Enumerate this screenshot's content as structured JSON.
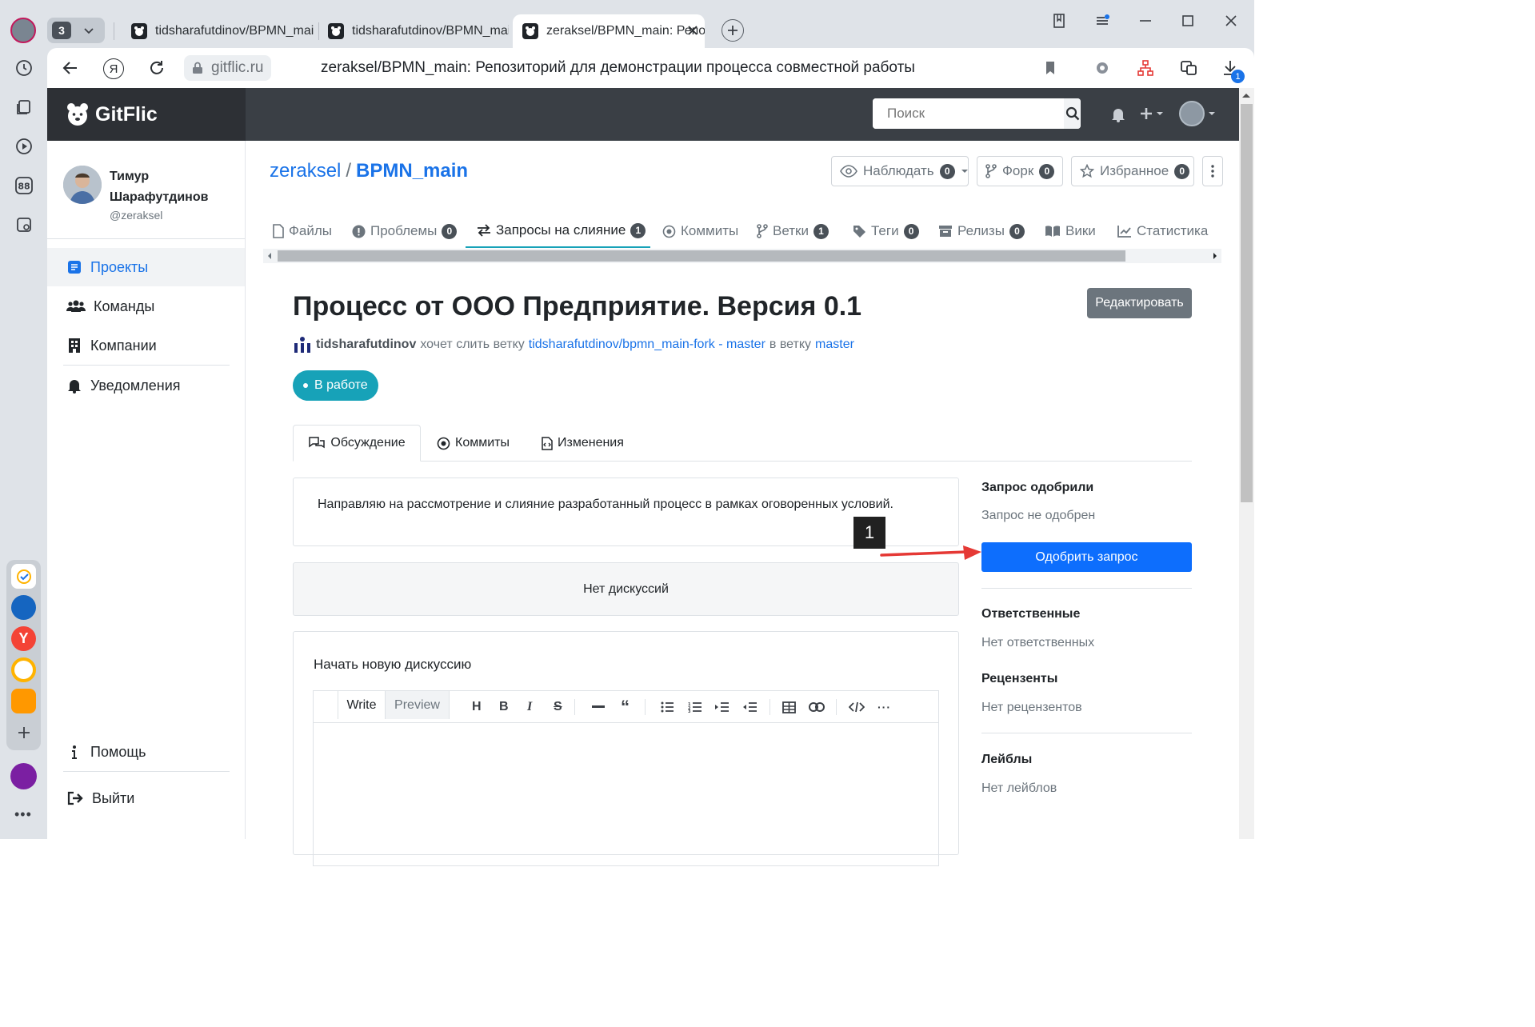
{
  "browser": {
    "tab_count": "3",
    "tabs": [
      {
        "title": "tidsharafutdinov/BPMN_main"
      },
      {
        "title": "tidsharafutdinov/BPMN_main"
      },
      {
        "title": "zeraksel/BPMN_main: Репозиторий"
      }
    ],
    "address": {
      "host": "gitflic.ru",
      "page_title": "zeraksel/BPMN_main: Репозиторий для демонстрации процесса совместной работы"
    },
    "downloads_badge": "1",
    "apps": [
      "Y"
    ]
  },
  "header": {
    "logo_text": "GitFlic",
    "search_placeholder": "Поиск"
  },
  "sidebar": {
    "user_name_line1": "Тимур",
    "user_name_line2": "Шарафутдинов",
    "user_handle": "@zeraksel",
    "items": [
      {
        "label": "Проекты"
      },
      {
        "label": "Команды"
      },
      {
        "label": "Компании"
      },
      {
        "label": "Уведомления"
      }
    ],
    "help_label": "Помощь",
    "logout_label": "Выйти"
  },
  "repo": {
    "owner": "zeraksel",
    "separator": "/",
    "name": "BPMN_main",
    "watch": {
      "label": "Наблюдать",
      "count": "0"
    },
    "fork": {
      "label": "Форк",
      "count": "0"
    },
    "star": {
      "label": "Избранное",
      "count": "0"
    }
  },
  "nav_tabs": [
    {
      "label": "Файлы",
      "count": ""
    },
    {
      "label": "Проблемы",
      "count": "0"
    },
    {
      "label": "Запросы на слияние",
      "count": "1"
    },
    {
      "label": "Коммиты",
      "count": ""
    },
    {
      "label": "Ветки",
      "count": "1"
    },
    {
      "label": "Теги",
      "count": "0"
    },
    {
      "label": "Релизы",
      "count": "0"
    },
    {
      "label": "Вики",
      "count": ""
    },
    {
      "label": "Статистика",
      "count": ""
    }
  ],
  "mr": {
    "title": "Процесс от ООО Предприятие. Версия 0.1",
    "edit_label": "Редактировать",
    "author": "tidsharafutdinov",
    "text_wants": "хочет слить ветку",
    "source_branch": "tidsharafutdinov/bpmn_main-fork - master",
    "text_into": "в ветку",
    "target_branch": "master",
    "status": "В работе",
    "subtabs": [
      {
        "label": "Обсуждение"
      },
      {
        "label": "Коммиты"
      },
      {
        "label": "Изменения"
      }
    ],
    "description": "Направляю на рассмотрение и слияние разработанный процесс в рамках оговоренных условий.",
    "no_discussions": "Нет дискуссий",
    "new_discussion_title": "Начать новую дискуссию",
    "editor": {
      "write_label": "Write",
      "preview_label": "Preview"
    }
  },
  "right_panel": {
    "approved_title": "Запрос одобрили",
    "approved_text": "Запрос не одобрен",
    "approve_button": "Одобрить запрос",
    "assignees_title": "Ответственные",
    "assignees_text": "Нет ответственных",
    "reviewers_title": "Рецензенты",
    "reviewers_text": "Нет рецензентов",
    "labels_title": "Лейблы",
    "labels_text": "Нет лейблов"
  },
  "annotation": {
    "marker": "1"
  },
  "colors": {
    "primary": "#0d6efd",
    "status": "#17a2b8",
    "header": "#3a3f45",
    "link": "#1a73e8",
    "annotation_arrow": "#e53935"
  }
}
